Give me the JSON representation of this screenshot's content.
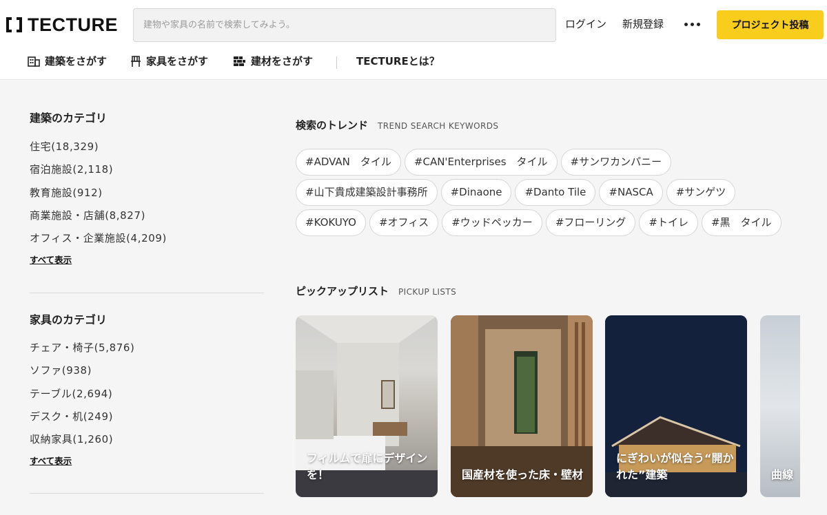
{
  "header": {
    "logo_text": "TECTURE",
    "search_placeholder": "建物や家具の名前で検索してみよう。",
    "login": "ログイン",
    "signup": "新規登録",
    "more_icon": "more-horizontal-icon",
    "post_button": "プロジェクト投稿",
    "accent_color": "#f8cd1b"
  },
  "subnav": {
    "architecture": "建築をさがす",
    "furniture": "家具をさがす",
    "materials": "建材をさがす",
    "about": "TECTUREとは？"
  },
  "sidebar": {
    "architecture": {
      "title": "建築のカテゴリ",
      "items": [
        "住宅(18,329)",
        "宿泊施設(2,118)",
        "教育施設(912)",
        "商業施設・店舗(8,827)",
        "オフィス・企業施設(4,209)"
      ],
      "show_all": "すべて表示"
    },
    "furniture": {
      "title": "家具のカテゴリ",
      "items": [
        "チェア・椅子(5,876)",
        "ソファ(938)",
        "テーブル(2,694)",
        "デスク・机(249)",
        "収納家具(1,260)"
      ],
      "show_all": "すべて表示"
    }
  },
  "trends": {
    "title": "検索のトレンド",
    "subtitle": "TREND SEARCH KEYWORDS",
    "tags": [
      "#ADVAN　タイル",
      "#CAN'Enterprises　タイル",
      "#サンワカンパニー",
      "#山下貴成建築設計事務所",
      "#Dinaone",
      "#Danto Tile",
      "#NASCA",
      "#サンゲツ",
      "#KOKUYO",
      "#オフィス",
      "#ウッドペッカー",
      "#フローリング",
      "#トイレ",
      "#黒　タイル"
    ]
  },
  "pickup": {
    "title": "ピックアップリスト",
    "subtitle": "PICKUP LISTS",
    "cards": [
      "フィルムで扉にデザインを！",
      "国産材を使った床・壁材",
      "にぎわいが似合う“開かれた”建築",
      "曲線"
    ]
  }
}
